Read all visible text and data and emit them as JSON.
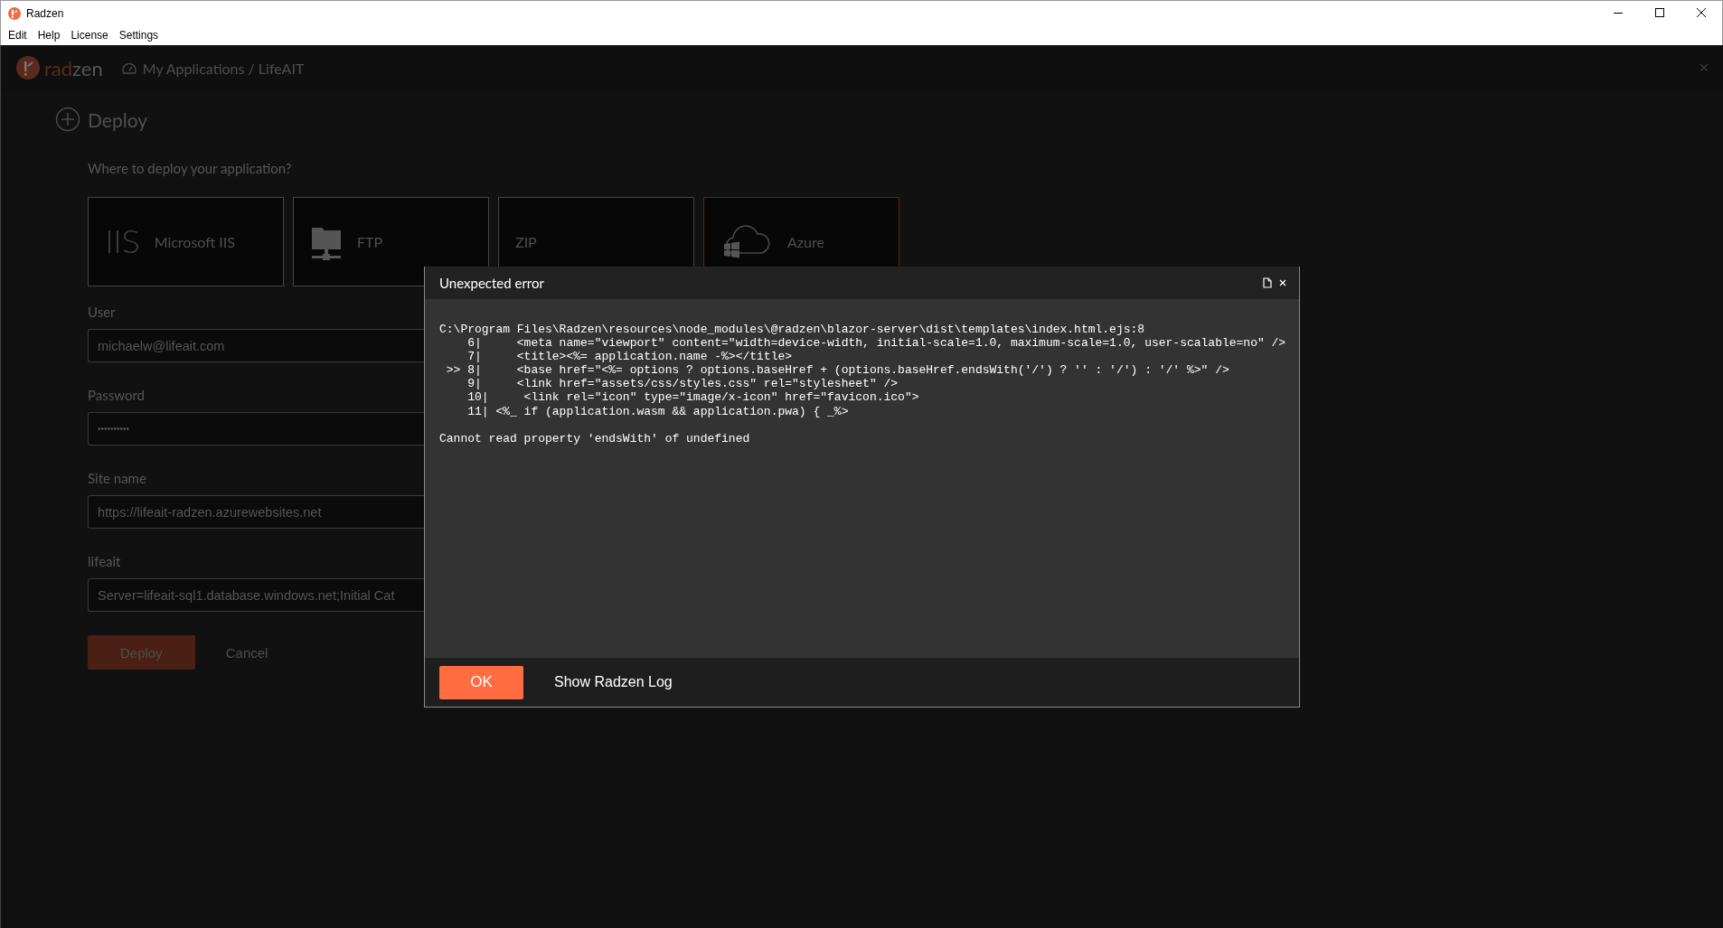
{
  "window": {
    "title": "Radzen"
  },
  "menu": [
    "Edit",
    "Help",
    "License",
    "Settings"
  ],
  "header": {
    "logo": {
      "accent": "rad",
      "rest": "zen"
    },
    "breadcrumb": "My Applications / LifeAIT"
  },
  "page": {
    "title": "Deploy",
    "question": "Where to deploy your application?",
    "targets": [
      {
        "kind": "iis",
        "icon_text": "IIS",
        "label": "Microsoft IIS",
        "selected": false
      },
      {
        "kind": "ftp",
        "label": "FTP",
        "selected": false
      },
      {
        "kind": "zip",
        "label": "ZIP",
        "selected": false
      },
      {
        "kind": "azure",
        "label": "Azure",
        "selected": true
      }
    ],
    "fields": [
      {
        "label": "User",
        "value": "michaelw@lifeait.com",
        "kind": "text"
      },
      {
        "label": "Password",
        "value": "••••••••••",
        "kind": "password"
      },
      {
        "label": "Site name",
        "value": "https://lifeait-radzen.azurewebsites.net",
        "kind": "text"
      },
      {
        "label": "lifeait",
        "value": "Server=lifeait-sql1.database.windows.net;Initial Cat",
        "kind": "text"
      }
    ],
    "buttons": [
      {
        "label": "Deploy",
        "kind": "primary"
      },
      {
        "label": "Cancel",
        "kind": "link"
      }
    ]
  },
  "dialog": {
    "title": "Unexpected error",
    "code_lines": [
      "C:\\Program Files\\Radzen\\resources\\node_modules\\@radzen\\blazor-server\\dist\\templates\\index.html.ejs:8",
      "    6|     <meta name=\"viewport\" content=\"width=device-width, initial-scale=1.0, maximum-scale=1.0, user-scalable=no\" />",
      "    7|     <title><%= application.name -%></title>",
      " >> 8|     <base href=\"<%= options ? options.baseHref + (options.baseHref.endsWith('/') ? '' : '/') : '/' %>\" />",
      "    9|     <link href=\"assets/css/styles.css\" rel=\"stylesheet\" />",
      "    10|     <link rel=\"icon\" type=\"image/x-icon\" href=\"favicon.ico\">",
      "    11| <%_ if (application.wasm && application.pwa) { _%>"
    ],
    "message": "Cannot read property 'endsWith' of undefined",
    "buttons": [
      {
        "label": "OK",
        "kind": "primary"
      },
      {
        "label": "Show Radzen Log",
        "kind": "link"
      }
    ]
  }
}
